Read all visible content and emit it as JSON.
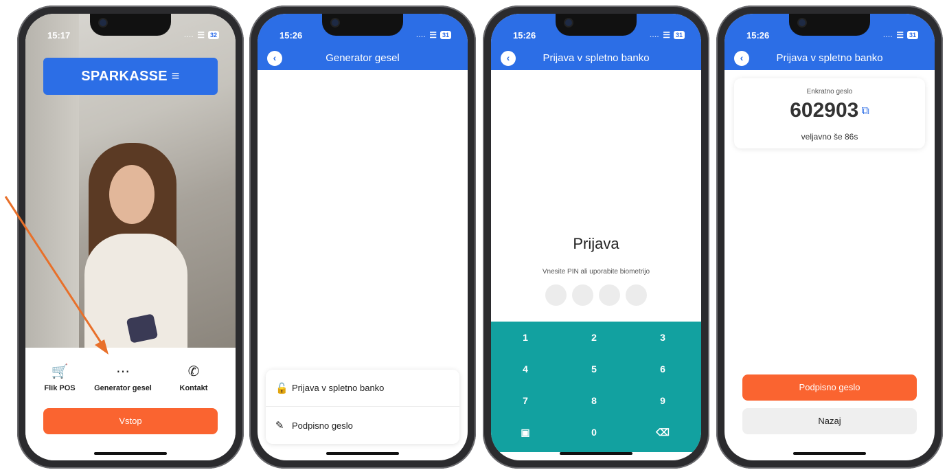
{
  "colors": {
    "brand_blue": "#2c6ee6",
    "accent_orange": "#fa6430",
    "keypad_teal": "#12a1a0",
    "annotation_arrow": "#e8702a"
  },
  "phone1": {
    "time": "15:17",
    "battery": "32",
    "logo": "SPARKASSE ≡",
    "quick_actions": [
      {
        "label": "Flik POS",
        "icon": "cart-icon"
      },
      {
        "label": "Generator gesel",
        "icon": "keypad-grid-icon"
      },
      {
        "label": "Kontakt",
        "icon": "phone-call-icon"
      }
    ],
    "enter_label": "Vstop"
  },
  "phone2": {
    "time": "15:26",
    "battery": "31",
    "title": "Generator gesel",
    "sheet_items": [
      {
        "label": "Prijava v spletno banko",
        "icon": "padlock-icon"
      },
      {
        "label": "Podpisno geslo",
        "icon": "pen-icon"
      }
    ]
  },
  "phone3": {
    "time": "15:26",
    "battery": "31",
    "title": "Prijava v spletno banko",
    "heading": "Prijava",
    "subtitle": "Vnesite PIN ali uporabite biometrijo",
    "keys": [
      "1",
      "2",
      "3",
      "4",
      "5",
      "6",
      "7",
      "8",
      "9",
      "",
      "0",
      ""
    ],
    "key_icons": {
      "biometric": "face-id-icon",
      "delete": "backspace-icon"
    }
  },
  "phone4": {
    "time": "15:26",
    "battery": "31",
    "title": "Prijava v spletno banko",
    "otp_label": "Enkratno geslo",
    "otp_value": "602903",
    "validity": "veljavno še 86s",
    "sign_label": "Podpisno geslo",
    "back_label": "Nazaj"
  }
}
